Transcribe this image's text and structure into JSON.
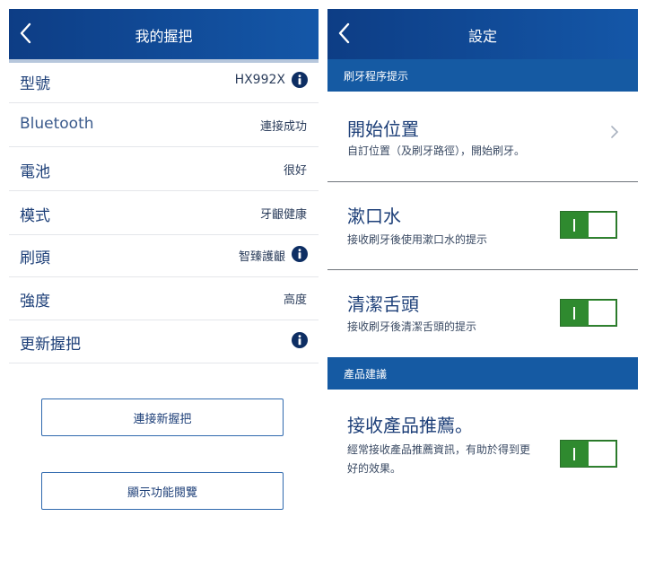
{
  "left": {
    "header": {
      "title": "我的握把"
    },
    "rows": [
      {
        "label": "型號",
        "value": "HX992X"
      },
      {
        "label": "Bluetooth",
        "value": "連接成功"
      },
      {
        "label": "電池",
        "value": "很好"
      },
      {
        "label": "模式",
        "value": "牙齦健康"
      },
      {
        "label": "刷頭",
        "value": "智臻護齦"
      },
      {
        "label": "強度",
        "value": "高度"
      },
      {
        "label": "更新握把",
        "value": ""
      }
    ],
    "buttons": {
      "connect_new": "連接新握把",
      "show_features": "顯示功能閱覽"
    }
  },
  "right": {
    "header": {
      "title": "設定"
    },
    "section1": "刷牙程序提示",
    "items": [
      {
        "title": "開始位置",
        "desc": "自訂位置（及刷牙路徑），開始刷牙。"
      },
      {
        "title": "漱口水",
        "desc": "接收刷牙後使用漱口水的提示",
        "toggle": "on"
      },
      {
        "title": "清潔舌頭",
        "desc": "接收刷牙後清潔舌頭的提示",
        "toggle": "on"
      }
    ],
    "section2": "產品建議",
    "product": {
      "title": "接收產品推薦。",
      "desc1": "經常接收產品推薦資訊，有助於得到更",
      "desc2": "好的效果。",
      "toggle": "on"
    }
  },
  "colors": {
    "header": "#1457a8",
    "section": "#155aa3",
    "toggle_on": "#2f8a2f",
    "text": "#1d3f78"
  },
  "icons": [
    "back-icon",
    "info-icon",
    "chevron-right-icon"
  ]
}
